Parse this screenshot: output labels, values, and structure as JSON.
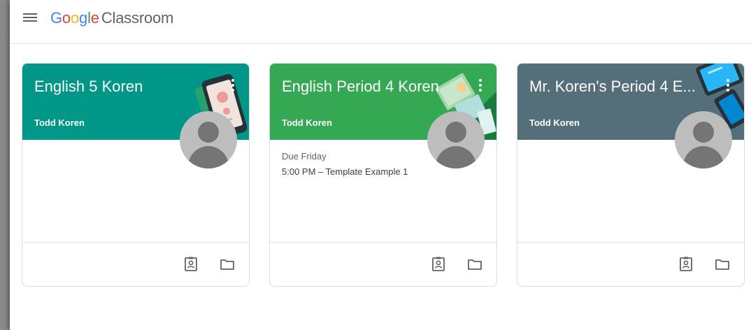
{
  "app": {
    "brand_google": [
      "G",
      "o",
      "o",
      "g",
      "l",
      "e"
    ],
    "brand_product": "Classroom",
    "menu_icon": "hamburger-menu-icon"
  },
  "colors": {
    "teal": "#009688",
    "green": "#34A853",
    "slate": "#546E7A",
    "avatar_bg": "#BDBDBD",
    "avatar_fg": "#757575"
  },
  "cards": [
    {
      "title": "English 5 Koren",
      "teacher": "Todd Koren",
      "due_label": "",
      "due_item": "",
      "icons": [
        "assignment-portrait-icon",
        "folder-icon"
      ]
    },
    {
      "title": "English Period 4 Koren",
      "teacher": "Todd Koren",
      "due_label": "Due Friday",
      "due_item": "5:00 PM – Template Example 1",
      "icons": [
        "assignment-portrait-icon",
        "folder-icon"
      ]
    },
    {
      "title": "Mr. Koren's Period 4 E...",
      "teacher": "Todd Koren",
      "due_label": "",
      "due_item": "",
      "icons": [
        "assignment-portrait-icon",
        "folder-icon"
      ]
    }
  ]
}
